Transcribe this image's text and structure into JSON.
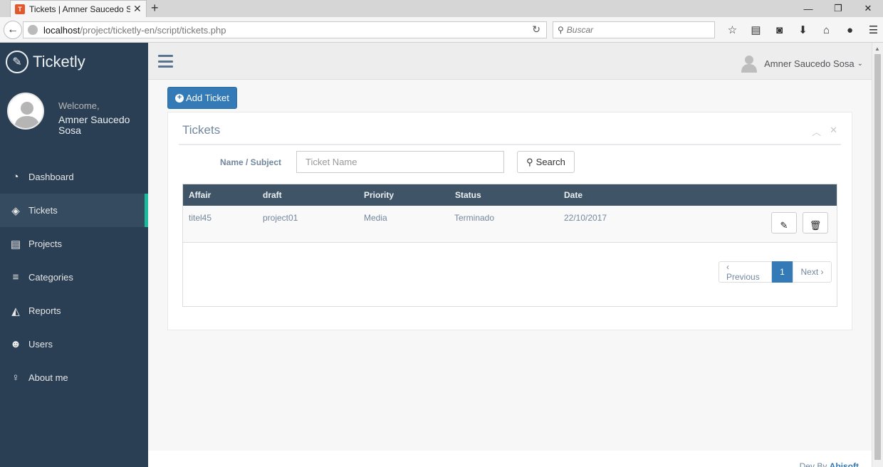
{
  "browser": {
    "tab_title": "Tickets | Amner Saucedo S...",
    "favicon_letter": "T",
    "url_host": "localhost",
    "url_path": "/project/ticketly-en/script/tickets.php",
    "search_placeholder": "Buscar"
  },
  "sidebar": {
    "brand": "Ticketly",
    "welcome": "Welcome,",
    "username": "Amner Saucedo Sosa",
    "items": [
      {
        "label": "Dashboard",
        "icon": "dashboard-icon"
      },
      {
        "label": "Tickets",
        "icon": "ticket-icon",
        "active": true
      },
      {
        "label": "Projects",
        "icon": "list-icon"
      },
      {
        "label": "Categories",
        "icon": "align-left-icon"
      },
      {
        "label": "Reports",
        "icon": "area-chart-icon"
      },
      {
        "label": "Users",
        "icon": "users-icon"
      },
      {
        "label": "About me",
        "icon": "person-icon"
      }
    ]
  },
  "header": {
    "user_name": "Amner Saucedo Sosa"
  },
  "main": {
    "add_button": "Add Ticket",
    "panel_title": "Tickets",
    "filter_label": "Name / Subject",
    "filter_placeholder": "Ticket Name",
    "search_button": "Search",
    "table": {
      "columns": [
        "Affair",
        "draft",
        "Priority",
        "Status",
        "Date"
      ],
      "rows": [
        [
          "titel45",
          "project01",
          "Media",
          "Terminado",
          "22/10/2017"
        ]
      ]
    },
    "pagination": {
      "previous": "‹ Previous",
      "current": "1",
      "next": "Next ›"
    }
  },
  "footer": {
    "prefix": "Dev By",
    "author": "Abisoft"
  },
  "colors": {
    "sidebar_bg": "#2a3f54",
    "accent_active": "#1abb9c",
    "primary": "#337ab7",
    "table_header": "#405467"
  }
}
